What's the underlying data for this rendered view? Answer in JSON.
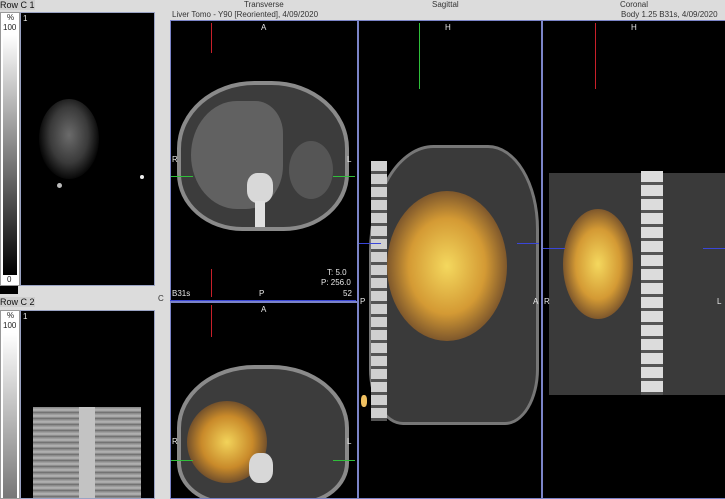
{
  "header": {
    "left_title": "Row C 1",
    "transverse": "Transverse",
    "sagittal": "Sagittal",
    "coronal": "Coronal",
    "study": "Liver Tomo - Y90 [Reoriented], 4/09/2020",
    "series_right": "Body 1.25  B31s, 4/09/2020"
  },
  "row_c1": {
    "scale_unit": "%",
    "scale_max": "100",
    "scale_min": "0",
    "frame_index": "1"
  },
  "row_c2": {
    "title": "Row C 2",
    "scale_unit": "%",
    "scale_max": "100",
    "frame_index": "1"
  },
  "transverse_top": {
    "orient_top": "A",
    "orient_left": "R",
    "orient_right": "L",
    "kernel": "B31s",
    "orient_bottom": "P",
    "t_value": "T: 5.0",
    "p_value": "P: 256.0",
    "slice": "52"
  },
  "transverse_bottom": {
    "orient_top": "A",
    "orient_left": "R",
    "orient_right": "L"
  },
  "sagittal": {
    "orient_top": "H",
    "orient_left": "P",
    "orient_right": "A"
  },
  "coronal": {
    "orient_top": "H",
    "orient_left": "R",
    "orient_right": "L"
  },
  "side_marker": "C",
  "colors": {
    "crosshair_red": "#c8202a",
    "crosshair_green": "#2fbf3a",
    "crosshair_blue": "#3a46d8",
    "viewport_border": "#7b84c8"
  }
}
